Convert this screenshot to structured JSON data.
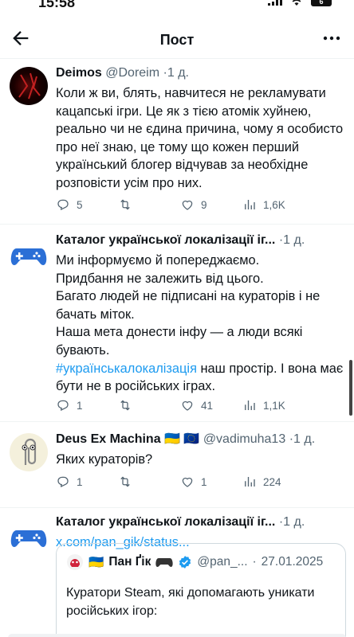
{
  "status_bar": {
    "time": "15:58",
    "battery": "6"
  },
  "top_bar": {
    "title": "Пост"
  },
  "posts": [
    {
      "name": "Deimos",
      "handle": "@Doreim",
      "sep": "·",
      "time": "1 д.",
      "text": "Коли ж ви, блять, навчитеся не рекламувати кацапські ігри. Це як з тією атомік хуйнею, реально чи не єдина причина, чому я особисто про неї знаю, це тому що кожен перший український блогер відчував за необхідне розповісти усім про них.",
      "replies": "5",
      "reposts": "",
      "likes": "9",
      "views": "1,6K"
    },
    {
      "name": "Каталог української локалізації іг...",
      "sep": "·",
      "time": "1 д.",
      "line1": "Ми інформуємо й попереджаємо.",
      "line2": "Придбання не залежить від цього.",
      "line3": "Багато людей не підписані на кураторів і не бачать міток.",
      "line4": "Наша мета донести інфу — а люди всякі бувають.",
      "hashtag": "#українськалокалізація",
      "line5": " наш простір. І вона має бути не в російських іграх.",
      "replies": "1",
      "reposts": "",
      "likes": "41",
      "views": "1,1K"
    },
    {
      "name": "Deus Ex Machina",
      "flags": "🇺🇦 🇪🇺",
      "handle": "@vadimuha13",
      "sep": "·",
      "time": "1 д.",
      "text": "Яких кураторів?",
      "replies": "1",
      "reposts": "",
      "likes": "1",
      "views": "224"
    },
    {
      "name": "Каталог української локалізації іг...",
      "sep": "·",
      "time": "1 д.",
      "link": "x.com/pan_gik/status..."
    }
  ],
  "quote": {
    "flag": "🇺🇦",
    "name": "Пан Ґік",
    "handle": "@pan_...",
    "sep": "·",
    "date": "27.01.2025",
    "text": "Куратори Steam, які допомагають уникати російських ігор:"
  },
  "colors": {
    "accent": "#1d9bf0",
    "muted": "#536471",
    "text": "#0f1419",
    "border": "#eff3f4"
  },
  "icons": [
    "back-arrow-icon",
    "more-dots-icon",
    "reply-icon",
    "repost-icon",
    "like-icon",
    "views-icon",
    "verified-badge-icon",
    "gamepad-icon"
  ]
}
